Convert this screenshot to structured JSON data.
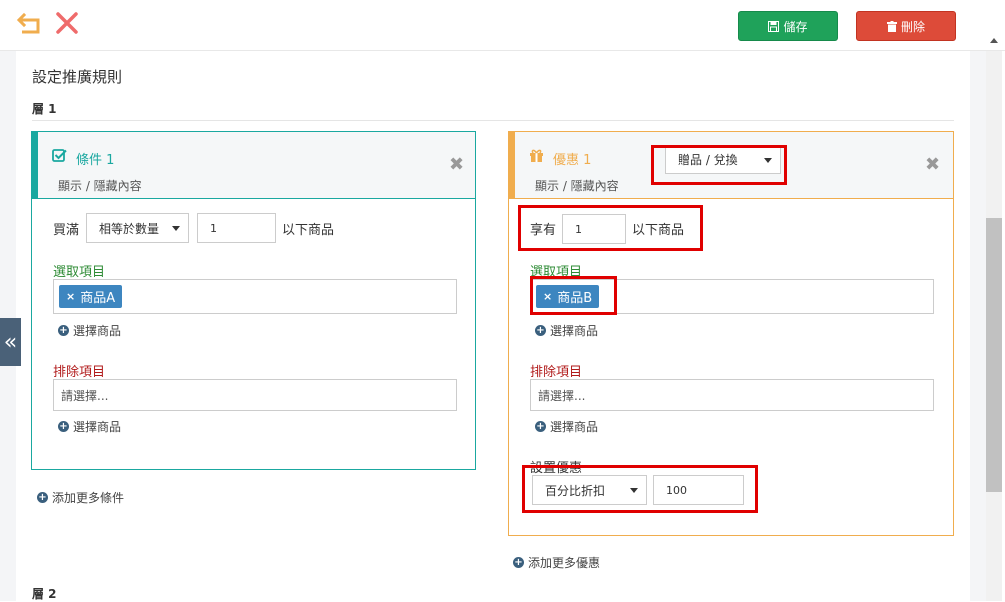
{
  "toolbar": {
    "save_label": "儲存",
    "delete_label": "刪除"
  },
  "page": {
    "title": "設定推廣規則",
    "layer1_label": "層 1",
    "layer2_label": "層 2"
  },
  "condition": {
    "title": "條件 1",
    "toggle": "顯示 / 隱藏內容",
    "buy_prefix": "買滿",
    "qty_mode": "相等於數量",
    "qty_value": "1",
    "buy_suffix": "以下商品",
    "select_label": "選取項目",
    "selected_tag": "商品A",
    "add_product_1": "選擇商品",
    "exclude_label": "排除項目",
    "exclude_placeholder": "請選擇...",
    "add_product_2": "選擇商品",
    "add_more": "添加更多條件"
  },
  "offer": {
    "title": "優惠 1",
    "toggle": "顯示 / 隱藏內容",
    "type_select": "贈品 / 兌換",
    "enjoy_prefix": "享有",
    "qty_value": "1",
    "enjoy_suffix": "以下商品",
    "select_label": "選取項目",
    "selected_tag": "商品B",
    "add_product_1": "選擇商品",
    "exclude_label": "排除項目",
    "exclude_placeholder": "請選擇...",
    "add_product_2": "選擇商品",
    "discount_label": "設置優惠",
    "discount_mode": "百分比折扣",
    "discount_value": "100",
    "add_more": "添加更多優惠"
  },
  "colors": {
    "save": "#1fa25a",
    "delete": "#dd4b39",
    "condition_accent": "#1aa8a0",
    "offer_accent": "#f0ad4e",
    "tag": "#3d86c0",
    "highlight": "#e00000"
  }
}
